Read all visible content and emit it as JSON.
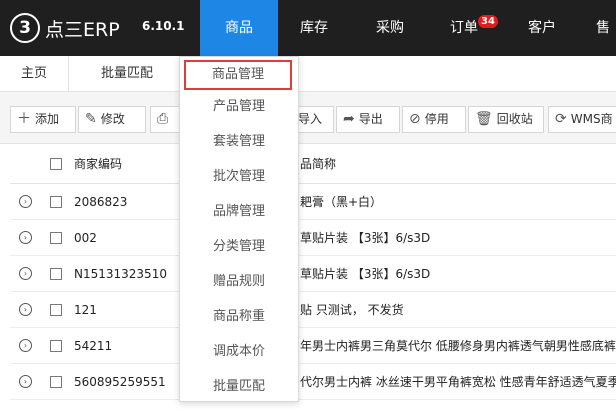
{
  "app": {
    "logo_mark": "3",
    "logo_text": "点三ERP",
    "version": "6.10.1"
  },
  "nav": {
    "items": [
      {
        "label": "商品",
        "active": true
      },
      {
        "label": "库存"
      },
      {
        "label": "采购"
      },
      {
        "label": "订单",
        "badge": "34"
      },
      {
        "label": "客户"
      },
      {
        "label": "售"
      }
    ]
  },
  "tabs": [
    "主页",
    "批量匹配"
  ],
  "toolbar": {
    "buttons": [
      {
        "icon": "plus-icon",
        "label": "添加"
      },
      {
        "icon": "edit-icon",
        "label": "修改"
      },
      {
        "icon": "print-icon",
        "label": ""
      },
      {
        "icon": "import-icon",
        "label": "导入"
      },
      {
        "icon": "export-icon",
        "label": "导出"
      },
      {
        "icon": "disable-icon",
        "label": "停用"
      },
      {
        "icon": "trash-icon",
        "label": "回收站"
      },
      {
        "icon": "sync-icon",
        "label": "WMS商"
      }
    ]
  },
  "table": {
    "headers": {
      "code": "商家编码",
      "name": "品简称"
    },
    "rows": [
      {
        "code": "2086823",
        "name": "耙膏（黑+白）"
      },
      {
        "code": "002",
        "name": "草贴片装 【3张】6/s3D"
      },
      {
        "code": "N15131323510",
        "name": "草贴片装 【3张】6/s3D"
      },
      {
        "code": "121",
        "name": "贴 只测试， 不发货"
      },
      {
        "code": "54211",
        "name": "年男士内裤男三角莫代尔 低腰修身男内裤透气朝男性感底裤"
      },
      {
        "code": "560895259551",
        "name": "代尔男士内裤 冰丝速干男平角裤宽松 性感青年舒适透气夏季"
      }
    ]
  },
  "dropdown": {
    "items": [
      {
        "label": "商品管理",
        "highlight": true
      },
      {
        "label": "产品管理"
      },
      {
        "label": "套装管理"
      },
      {
        "label": "批次管理"
      },
      {
        "label": "品牌管理"
      },
      {
        "label": "分类管理"
      },
      {
        "label": "赠品规则"
      },
      {
        "label": "商品称重"
      },
      {
        "label": "调成本价"
      },
      {
        "label": "批量匹配"
      }
    ]
  },
  "colors": {
    "topnav_bg": "#1f1f1f",
    "nav_active": "#1e87e5",
    "badge": "#e41b1b",
    "highlight_border": "#e03c3c"
  }
}
